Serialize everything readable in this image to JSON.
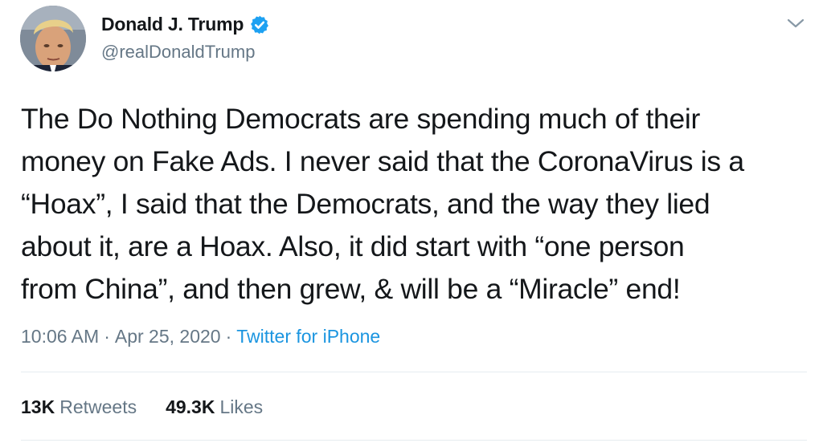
{
  "header": {
    "display_name": "Donald J. Trump",
    "handle": "@realDonaldTrump",
    "verified_icon": "verified-badge-icon",
    "menu_icon": "chevron-down-icon"
  },
  "tweet": {
    "text": "The Do Nothing Democrats are spending much of their\nmoney on Fake Ads. I never said that the CoronaVirus is a\n“Hoax”, I said that the Democrats, and the way they lied\nabout it, are a Hoax. Also, it did start with “one person\nfrom China”, and then grew, & will be a “Miracle” end!",
    "time": "10:06 AM",
    "separator": "·",
    "date": "Apr 25, 2020",
    "source": "Twitter for iPhone"
  },
  "stats": {
    "retweets_count": "13K",
    "retweets_label": "Retweets",
    "likes_count": "49.3K",
    "likes_label": "Likes"
  },
  "colors": {
    "accent": "#1b95e0",
    "verified": "#1da1f2",
    "text_primary": "#14171a",
    "text_secondary": "#657786",
    "divider": "#e6ecf0"
  }
}
